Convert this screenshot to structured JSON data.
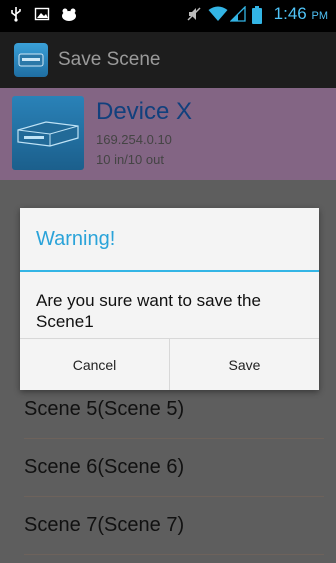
{
  "status_bar": {
    "time": "1:46",
    "ampm": "PM",
    "time_color": "#4fc3f7"
  },
  "action_bar": {
    "title": "Save Scene"
  },
  "device": {
    "name": "Device X",
    "ip": "169.254.0.10",
    "io": "10 in/10 out"
  },
  "scenes": [
    {
      "label": "Scene 5(Scene 5)"
    },
    {
      "label": "Scene 6(Scene 6)"
    },
    {
      "label": "Scene 7(Scene 7)"
    }
  ],
  "dialog": {
    "title": "Warning!",
    "message": "Are you sure want to save the Scene1",
    "cancel_label": "Cancel",
    "save_label": "Save",
    "accent_color": "#33b5e5"
  }
}
